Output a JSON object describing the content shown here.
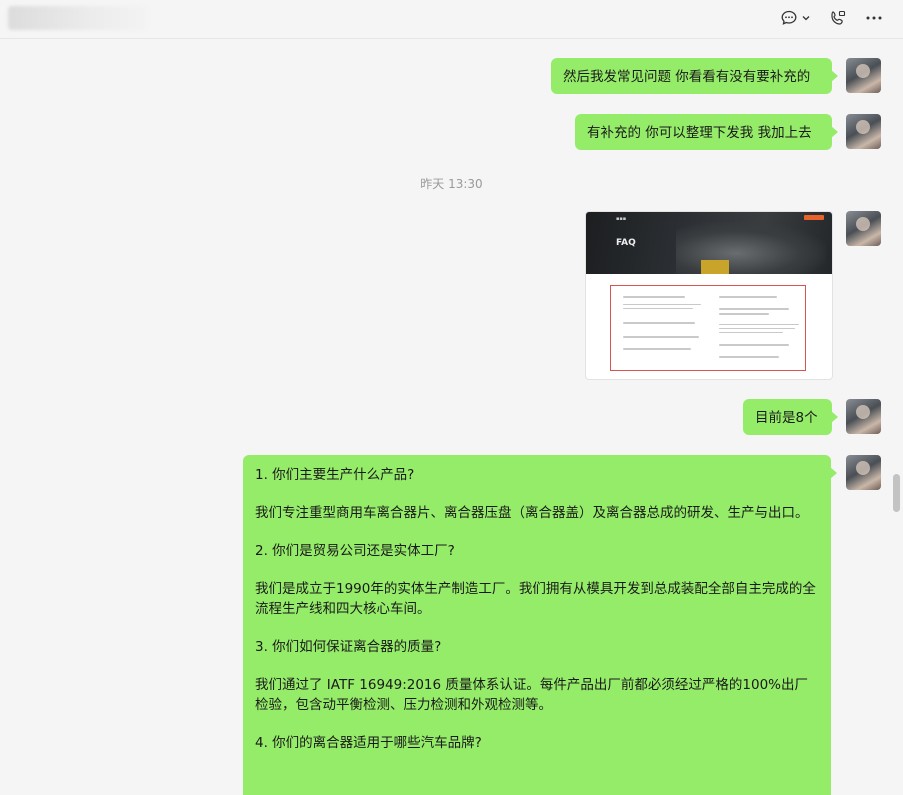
{
  "header": {
    "icons": [
      "chat-more-icon",
      "chevron-down-icon",
      "video-call-icon",
      "more-icon"
    ]
  },
  "messages": {
    "m1": "然后我发常见问题 你看看有没有要补充的",
    "m2": "有补充的 你可以整理下发我 我加上去",
    "timestamp": "昨天 13:30",
    "image": {
      "faq_title": "FAQ"
    },
    "m4": "目前是8个",
    "long": {
      "q1": "1. 你们主要生产什么产品?",
      "a1": "我们专注重型商用车离合器片、离合器压盘（离合器盖）及离合器总成的研发、生产与出口。",
      "q2": "2. 你们是贸易公司还是实体工厂?",
      "a2": "我们是成立于1990年的实体生产制造工厂。我们拥有从模具开发到总成装配全部自主完成的全流程生产线和四大核心车间。",
      "q3": "3. 你们如何保证离合器的质量?",
      "a3": "我们通过了 IATF 16949:2016 质量体系认证。每件产品出厂前都必须经过严格的100%出厂检验，包含动平衡检测、压力检测和外观检测等。",
      "q4": "4. 你们的离合器适用于哪些汽车品牌?"
    }
  },
  "colors": {
    "bubble": "#95ec69",
    "background": "#f5f5f5"
  }
}
